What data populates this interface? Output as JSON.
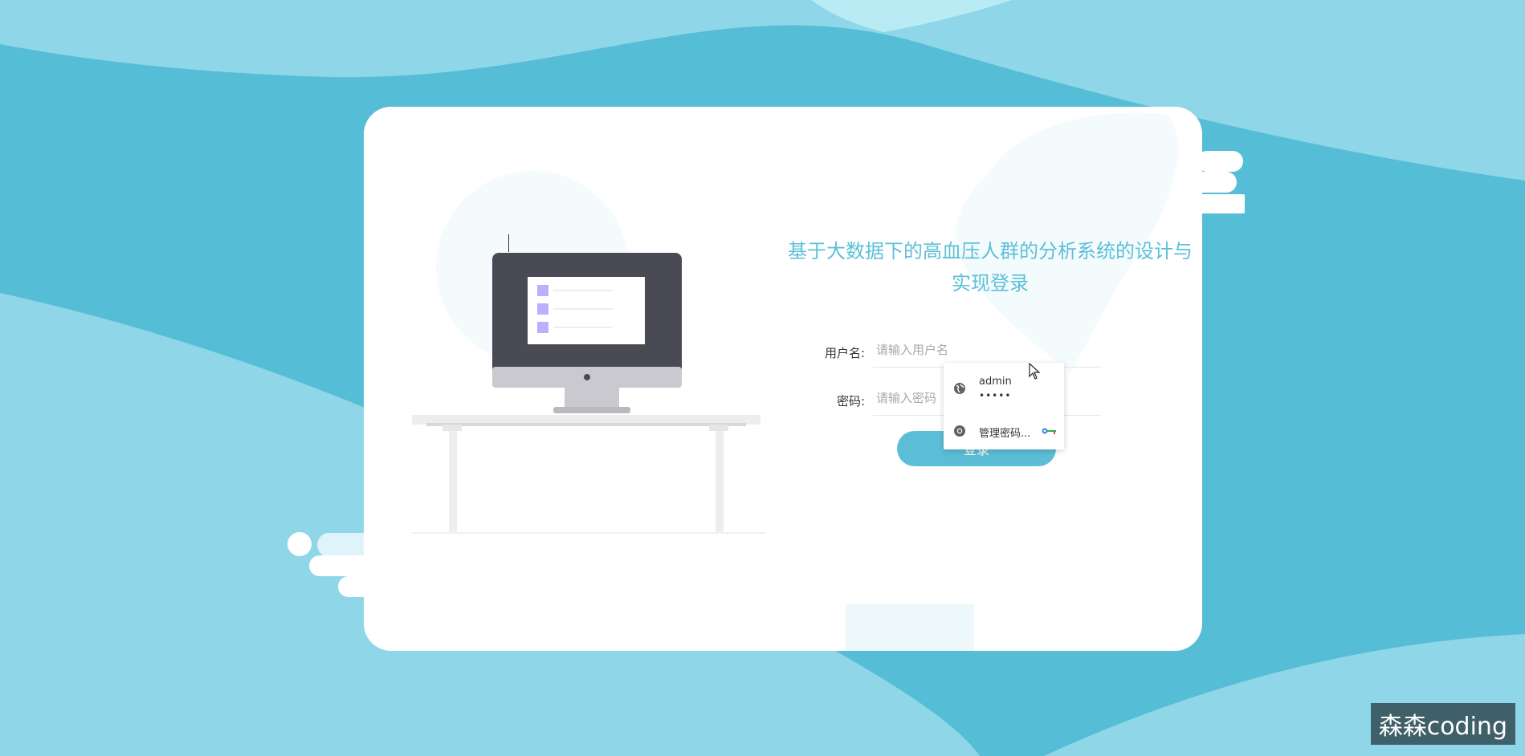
{
  "title": "基于大数据下的高血压人群的分析系统的设计与实现登录",
  "form": {
    "username_label": "用户名:",
    "username_placeholder": "请输入用户名",
    "password_label": "密码:",
    "password_placeholder": "请输入密码",
    "login_button": "登录"
  },
  "autofill": {
    "username": "admin",
    "password_mask": "•••••",
    "manage_label": "管理密码..."
  },
  "watermark": "森森coding",
  "colors": {
    "accent": "#5cbed6",
    "background": "#55bdd6",
    "wave_light": "#8fd6e8",
    "monitor": "#4a4a55",
    "screen_icons": "#b9b1ff"
  },
  "icons": {
    "credential": "globe-icon",
    "manage": "chrome-icon",
    "key": "key-icon",
    "pointer": "mouse-cursor-icon"
  }
}
